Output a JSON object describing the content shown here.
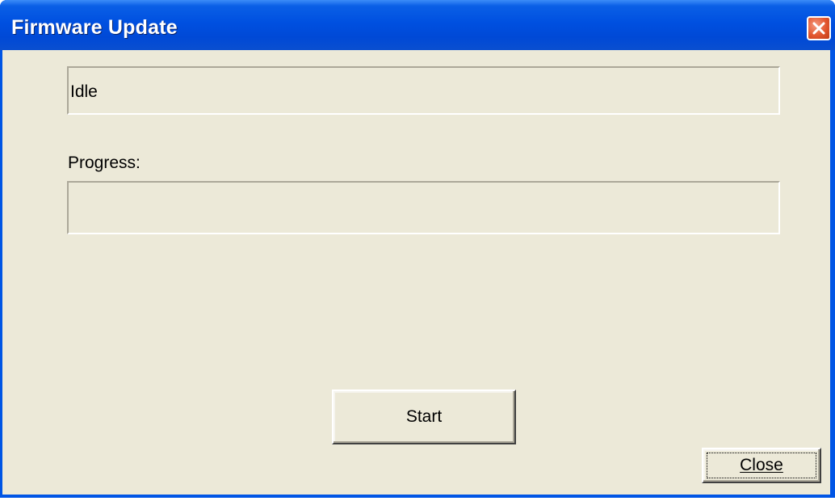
{
  "window": {
    "title": "Firmware Update",
    "close_icon": "close-x-icon",
    "colors": {
      "titlebar": "#0050e0",
      "client": "#ece9d8",
      "close_button": "#e2562f"
    }
  },
  "status": {
    "text": "Idle"
  },
  "progress": {
    "label": "Progress:",
    "value_percent": 0
  },
  "buttons": {
    "start_label": "Start",
    "close_label": "Close"
  }
}
